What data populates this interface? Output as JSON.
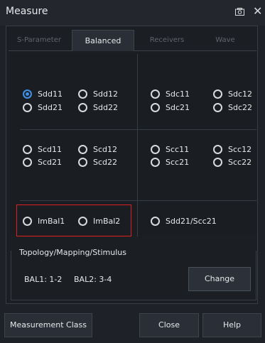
{
  "window": {
    "title": "Measure",
    "icons": [
      "camera-icon",
      "close-icon"
    ],
    "close_glyph": "✕"
  },
  "tabs": [
    {
      "label": "S-Parameter",
      "active": false
    },
    {
      "label": "Balanced",
      "active": true
    },
    {
      "label": "Receivers",
      "active": false
    },
    {
      "label": "Wave",
      "active": false
    }
  ],
  "params": {
    "sdd11": "Sdd11",
    "sdd12": "Sdd12",
    "sdc11": "Sdc11",
    "sdc12": "Sdc12",
    "sdd21": "Sdd21",
    "sdd22": "Sdd22",
    "sdc21": "Sdc21",
    "sdc22": "Sdc22",
    "scd11": "Scd11",
    "scd12": "Scd12",
    "scc11": "Scc11",
    "scc12": "Scc12",
    "scd21": "Scd21",
    "scd22": "Scd22",
    "scc21": "Scc21",
    "scc22": "Scc22",
    "imbal1": "ImBal1",
    "imbal2": "ImBal2",
    "sdd21_scc21": "Sdd21/Scc21",
    "selected": "Sdd11"
  },
  "topology": {
    "title": "Topology/Mapping/Stimulus",
    "bal1": "BAL1: 1-2",
    "bal2": "BAL2: 3-4",
    "change_label": "Change"
  },
  "footer": {
    "measurement_class": "Measurement Class",
    "close": "Close",
    "help": "Help"
  },
  "colors": {
    "accent": "#3e8fe0",
    "highlight": "#e02020",
    "background": "#1e2127"
  }
}
